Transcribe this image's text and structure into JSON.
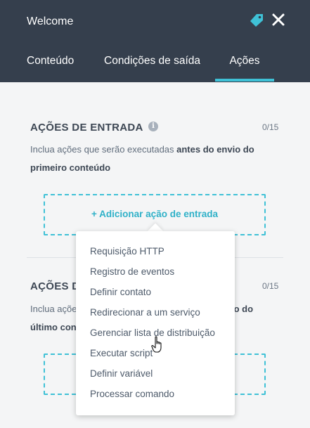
{
  "header": {
    "title": "Welcome",
    "tabs": [
      "Conteúdo",
      "Condições de saída",
      "Ações"
    ],
    "active_tab": "Ações"
  },
  "entry_actions": {
    "title": "AÇÕES DE ENTRADA",
    "counter": "0/15",
    "desc_start": "Inclua ações que serão executadas ",
    "desc_bold": "antes do envio do primeiro conteúdo",
    "add_label": "+ Adicionar ação de entrada"
  },
  "exit_actions": {
    "title_partial": "AÇÕES D",
    "counter": "0/15",
    "desc_line1_start": "Inclua açõe",
    "desc_line1_bold_end": "io do",
    "desc_line2_bold_partial": "último con"
  },
  "dropdown": {
    "items": [
      "Requisição HTTP",
      "Registro de eventos",
      "Definir contato",
      "Redirecionar a um serviço",
      "Gerenciar lista de distribuição",
      "Executar script",
      "Definir variável",
      "Processar comando"
    ]
  },
  "colors": {
    "header_bg": "#353f4d",
    "accent": "#3fc1d6",
    "page_bg": "#f4f5f6"
  },
  "icons": [
    "tag-icon",
    "close-icon",
    "info-icon",
    "hand-cursor-icon"
  ]
}
